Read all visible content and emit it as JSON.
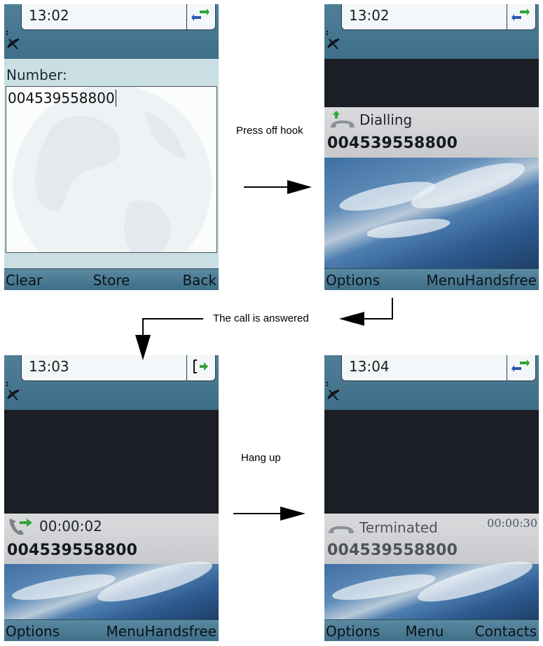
{
  "screens": {
    "entry": {
      "time": "13:02",
      "number_label": "Number:",
      "number_value": "004539558800",
      "softkeys": {
        "left": "Clear",
        "middle": "Store",
        "right": "Back"
      }
    },
    "dialling": {
      "time": "13:02",
      "status": "Dialling",
      "number": "004539558800",
      "softkeys": {
        "left": "Options",
        "middle": "Menu",
        "right": "Handsfree"
      }
    },
    "connected": {
      "time": "13:03",
      "duration": "00:00:02",
      "number": "004539558800",
      "softkeys": {
        "left": "Options",
        "middle": "Menu",
        "right": "Handsfree"
      }
    },
    "terminated": {
      "time": "13:04",
      "status": "Terminated",
      "duration": "00:00:30",
      "number": "004539558800",
      "softkeys": {
        "left": "Options",
        "middle": "Menu",
        "right": "Contacts"
      }
    }
  },
  "flow": {
    "press_off_hook": "Press off hook",
    "call_answered": "The call is answered",
    "hang_up": "Hang up"
  },
  "colors": {
    "status_bar": "#3f6f88",
    "entry_background": "#c9dfe4",
    "call_band": "#cfd1d4",
    "screen_dark": "#1c1e26"
  }
}
